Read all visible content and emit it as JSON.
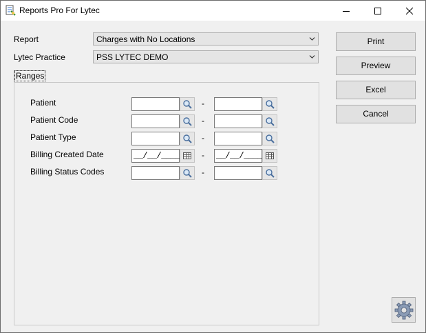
{
  "window": {
    "title": "Reports Pro For Lytec",
    "controls": [
      "minimize",
      "maximize",
      "close"
    ]
  },
  "report": {
    "label": "Report",
    "selected": "Charges with No Locations"
  },
  "practice": {
    "label": "Lytec Practice",
    "selected": "PSS LYTEC DEMO"
  },
  "tab": {
    "label": "Ranges"
  },
  "ranges": [
    {
      "label": "Patient",
      "from": "",
      "to": "",
      "type": "lookup"
    },
    {
      "label": "Patient Code",
      "from": "",
      "to": "",
      "type": "lookup"
    },
    {
      "label": "Patient Type",
      "from": "",
      "to": "",
      "type": "lookup"
    },
    {
      "label": "Billing Created Date",
      "from": "__/__/____",
      "to": "__/__/____",
      "type": "date"
    },
    {
      "label": "Billing Status Codes",
      "from": "",
      "to": "",
      "type": "lookup"
    }
  ],
  "range_separator": "-",
  "buttons": {
    "print": "Print",
    "preview": "Preview",
    "excel": "Excel",
    "cancel": "Cancel"
  },
  "icons": {
    "app": "report-document-icon",
    "lookup": "magnifier-icon",
    "date": "calendar-icon",
    "settings": "gear-icon"
  }
}
